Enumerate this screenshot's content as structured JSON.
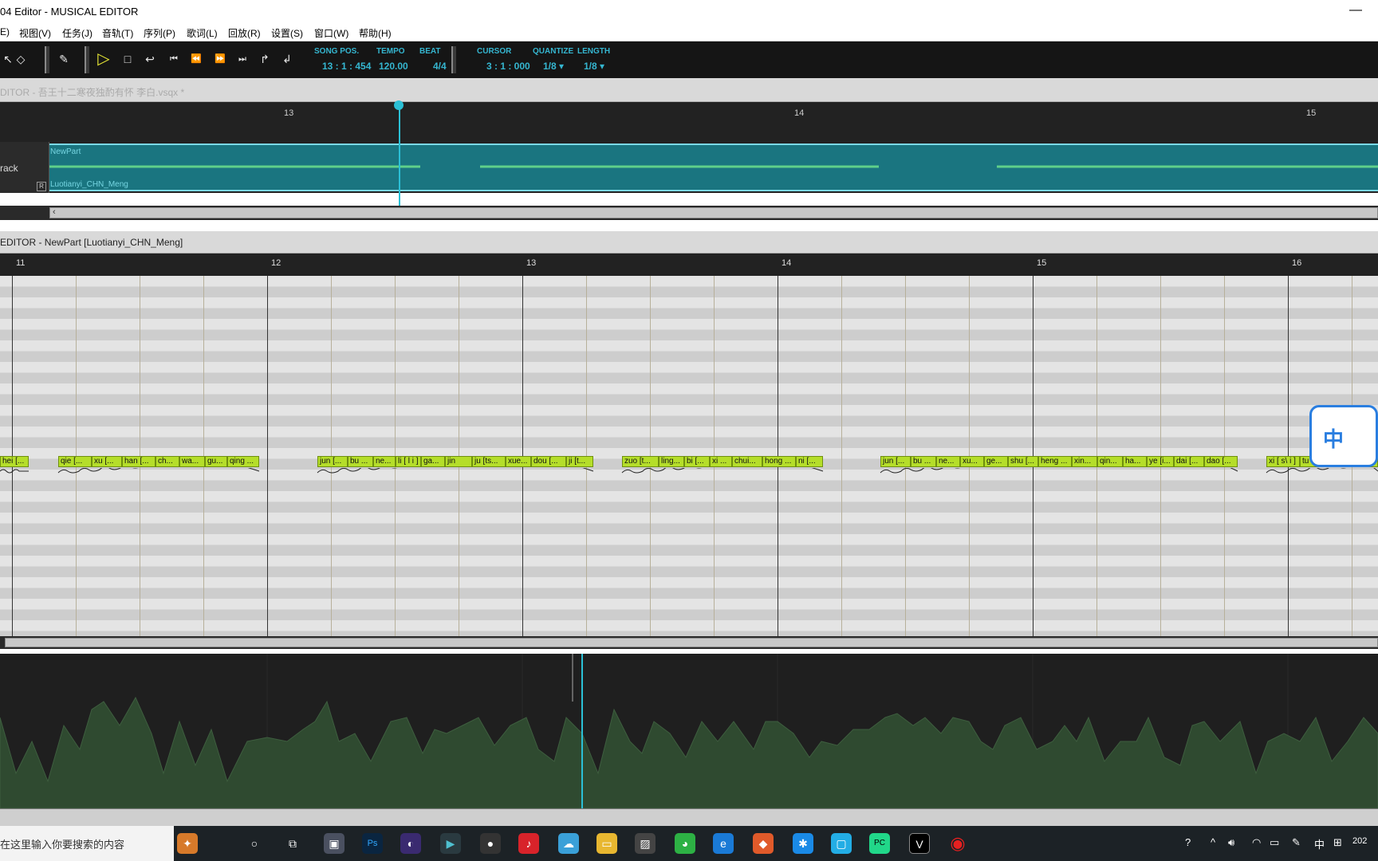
{
  "window": {
    "title": "04 Editor - MUSICAL EDITOR",
    "minimize": "—"
  },
  "menu": [
    "E)",
    "视图(V)",
    "任务(J)",
    "音轨(T)",
    "序列(P)",
    "歌词(L)",
    "回放(R)",
    "设置(S)",
    "窗口(W)",
    "帮助(H)"
  ],
  "toolbar": {
    "song_pos_label": "SONG POS.",
    "song_pos": "13 : 1 : 454",
    "tempo_label": "TEMPO",
    "tempo": "120.00",
    "beat_label": "BEAT",
    "beat": "4/4",
    "cursor_label": "CURSOR",
    "cursor": "3 : 1 : 000",
    "quantize_label": "QUANTIZE",
    "quantize": "1/8 ▾",
    "length_label": "LENGTH",
    "length": "1/8 ▾"
  },
  "arrangement": {
    "title": "DITOR - 吾王十二寒夜独酌有怀 李白.vsqx *",
    "ruler": [
      "13",
      "14",
      "15"
    ],
    "track_name": "rack",
    "part_name": "NewPart",
    "singer": "Luotianyi_CHN_Meng",
    "r_icon": "R"
  },
  "piano_roll": {
    "title": "EDITOR - NewPart [Luotianyi_CHN_Meng]",
    "ruler": [
      "11",
      "12",
      "13",
      "14",
      "15",
      "16"
    ],
    "notes": [
      "hei [...",
      "qie [...",
      "xu [...",
      "han [...",
      "ch...",
      "wa...",
      "gu...",
      "qing ...",
      "jun [...",
      "bu ...",
      "ne...",
      "li [ l i ]",
      "ga...",
      "jin",
      "ju [ts...",
      "xue...",
      "dou [...",
      "ji [t...",
      "zuo [t...",
      "ling...",
      "bi [...",
      "xi ...",
      "chui...",
      "hong ...",
      "ni [...",
      "jun [...",
      "bu ...",
      "ne...",
      "xu...",
      "ge...",
      "shu [...",
      "heng ...",
      "xin...",
      "qin...",
      "ha...",
      "ye [i...",
      "dai [...",
      "dao [...",
      "xi [ s\\ i ]",
      "tu"
    ]
  },
  "ime": {
    "label": "中"
  },
  "taskbar": {
    "search": "在这里输入你要搜索的内容",
    "lang": "中",
    "clock": "202"
  },
  "colors": {
    "toolbar_text": "#35b6d0",
    "part": "#1a7580",
    "note": "#b5de2a",
    "dynamics": "#2f4a30"
  }
}
